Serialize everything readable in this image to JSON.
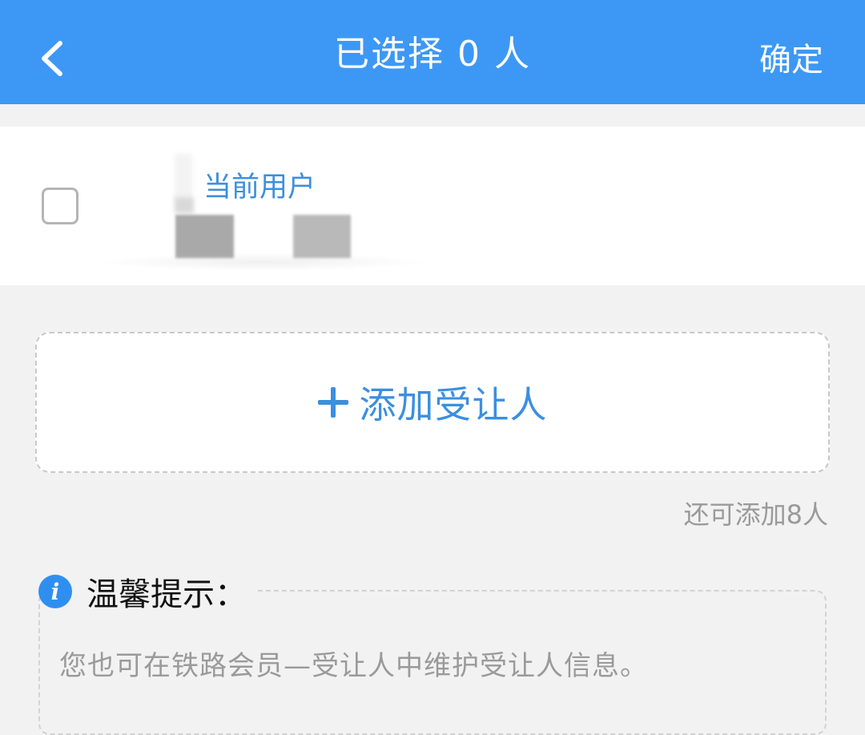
{
  "header": {
    "title": "已选择 0 人",
    "confirm_label": "确定",
    "back_icon": "chevron-left-icon",
    "background": "#3d98f5"
  },
  "current_user": {
    "tag": "当前用户",
    "checked": false
  },
  "add_passenger": {
    "label": "添加受让人",
    "icon": "plus-icon"
  },
  "remaining_text": "还可添加8人",
  "tip": {
    "icon": "info-icon",
    "title": "温馨提示：",
    "text": "您也可在铁路会员—受让人中维护受让人信息。"
  },
  "colors": {
    "accent": "#3b8fdf",
    "muted": "#9a9a9a",
    "page_bg": "#f2f2f2"
  }
}
